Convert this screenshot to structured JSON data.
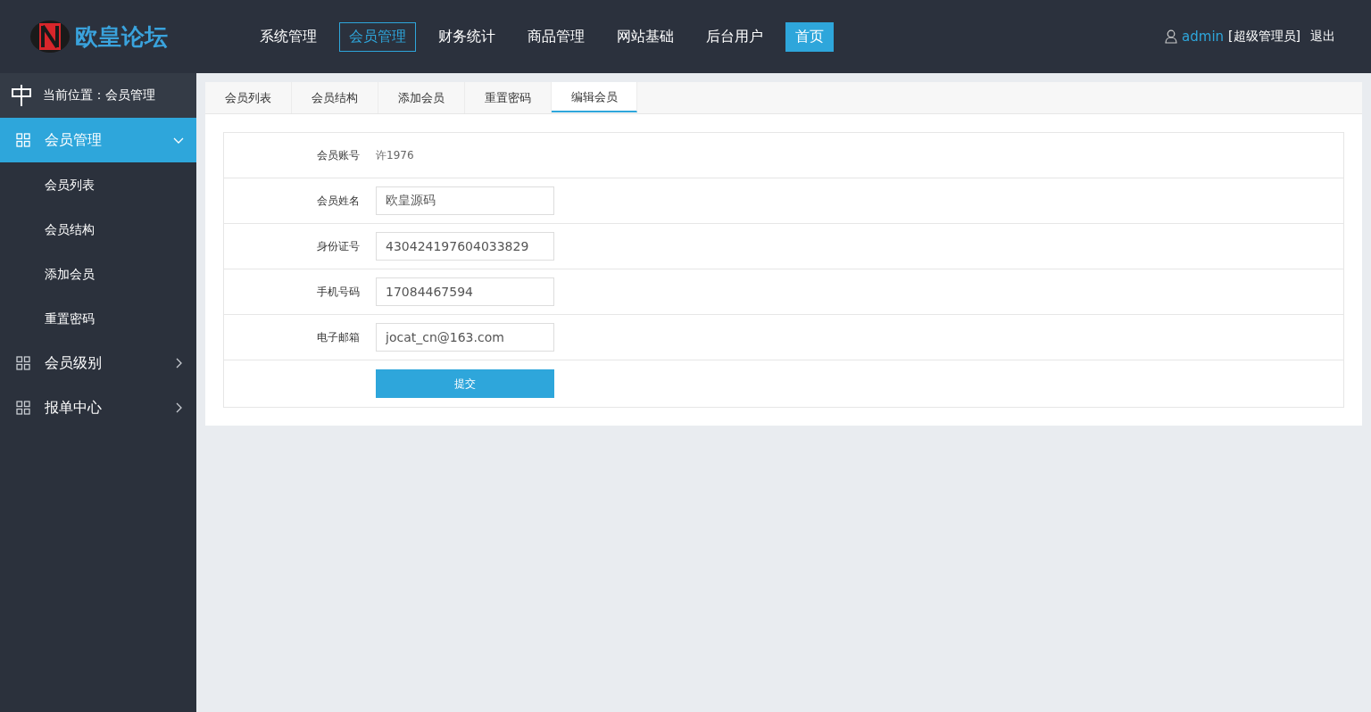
{
  "header": {
    "logo_text": "欧皇论坛",
    "nav": [
      {
        "label": "系统管理",
        "selected": false,
        "highlighted": false
      },
      {
        "label": "会员管理",
        "selected": true,
        "highlighted": false
      },
      {
        "label": "财务统计",
        "selected": false,
        "highlighted": false
      },
      {
        "label": "商品管理",
        "selected": false,
        "highlighted": false
      },
      {
        "label": "网站基础",
        "selected": false,
        "highlighted": false
      },
      {
        "label": "后台用户",
        "selected": false,
        "highlighted": false
      },
      {
        "label": "首页",
        "selected": false,
        "highlighted": true
      }
    ],
    "user": {
      "name": "admin",
      "role": "[超级管理员]",
      "logout": "退出"
    }
  },
  "sidebar": {
    "location": "当前位置：会员管理",
    "groups": [
      {
        "label": "会员管理",
        "selected": true,
        "expanded": true,
        "children": [
          {
            "label": "会员列表"
          },
          {
            "label": "会员结构"
          },
          {
            "label": "添加会员"
          },
          {
            "label": "重置密码"
          }
        ]
      },
      {
        "label": "会员级别",
        "selected": false,
        "expanded": false
      },
      {
        "label": "报单中心",
        "selected": false,
        "expanded": false
      }
    ]
  },
  "tabs": [
    {
      "label": "会员列表",
      "selected": false
    },
    {
      "label": "会员结构",
      "selected": false
    },
    {
      "label": "添加会员",
      "selected": false
    },
    {
      "label": "重置密码",
      "selected": false
    },
    {
      "label": "编辑会员",
      "selected": true
    }
  ],
  "form": {
    "rows": [
      {
        "kind": "static",
        "label": "会员账号",
        "value": "许1976"
      },
      {
        "kind": "input",
        "label": "会员姓名",
        "value": "欧皇源码"
      },
      {
        "kind": "input",
        "label": "身份证号",
        "value": "430424197604033829"
      },
      {
        "kind": "input",
        "label": "手机号码",
        "value": "17084467594"
      },
      {
        "kind": "input",
        "label": "电子邮箱",
        "value": "jocat_cn@163.com"
      }
    ],
    "submit": "提交"
  }
}
